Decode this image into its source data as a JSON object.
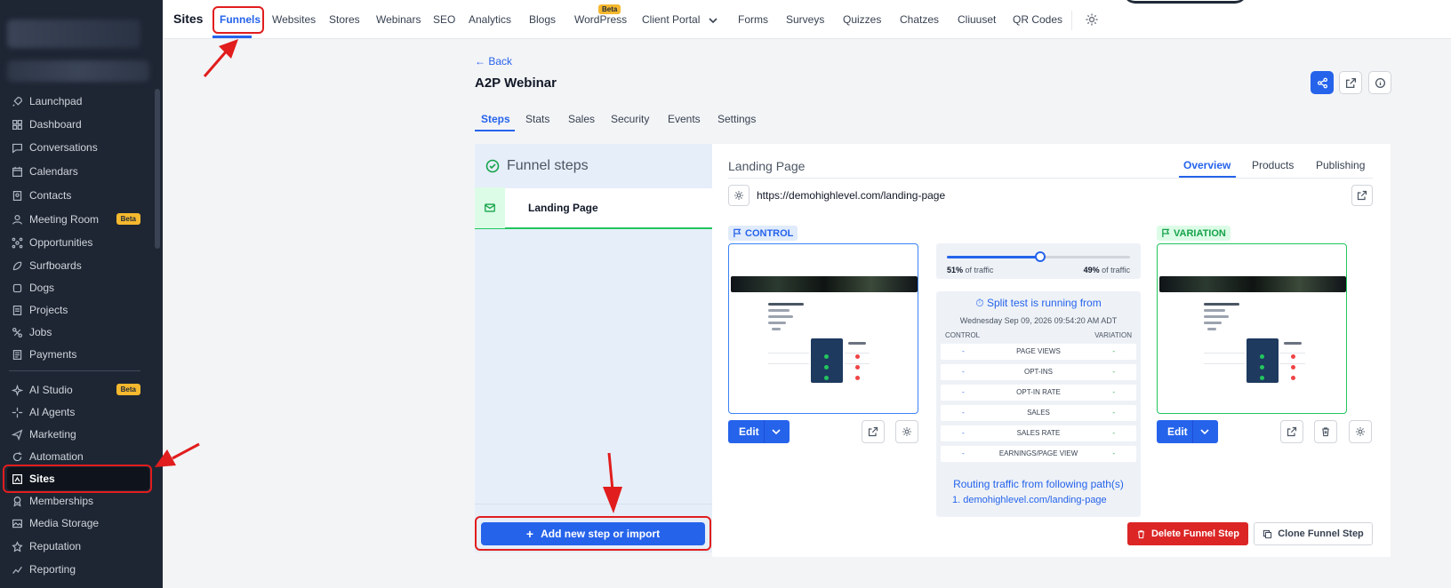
{
  "sidebar": {
    "items": [
      {
        "label": "Launchpad",
        "icon": "rocket-icon"
      },
      {
        "label": "Dashboard",
        "icon": "grid-icon"
      },
      {
        "label": "Conversations",
        "icon": "chat-icon"
      },
      {
        "label": "Calendars",
        "icon": "calendar-icon"
      },
      {
        "label": "Contacts",
        "icon": "contacts-icon"
      },
      {
        "label": "Meeting Room",
        "icon": "meeting-icon",
        "badge": "Beta"
      },
      {
        "label": "Opportunities",
        "icon": "opportunities-icon"
      },
      {
        "label": "Surfboards",
        "icon": "surfboard-icon"
      },
      {
        "label": "Dogs",
        "icon": "dog-icon"
      },
      {
        "label": "Projects",
        "icon": "projects-icon"
      },
      {
        "label": "Jobs",
        "icon": "jobs-icon"
      },
      {
        "label": "Payments",
        "icon": "payments-icon"
      },
      {
        "label": "AI Studio",
        "icon": "ai-studio-icon",
        "badge": "Beta"
      },
      {
        "label": "AI Agents",
        "icon": "ai-agents-icon"
      },
      {
        "label": "Marketing",
        "icon": "send-icon"
      },
      {
        "label": "Automation",
        "icon": "automation-icon"
      },
      {
        "label": "Sites",
        "icon": "sites-icon"
      },
      {
        "label": "Memberships",
        "icon": "memberships-icon"
      },
      {
        "label": "Media Storage",
        "icon": "media-icon"
      },
      {
        "label": "Reputation",
        "icon": "star-icon"
      },
      {
        "label": "Reporting",
        "icon": "chart-icon"
      }
    ]
  },
  "topnav": {
    "title": "Sites",
    "items": [
      "Funnels",
      "Websites",
      "Stores",
      "Webinars",
      "SEO",
      "Analytics",
      "Blogs",
      "WordPress",
      "Client Portal",
      "Forms",
      "Surveys",
      "Quizzes",
      "Chatzes",
      "Cliuuset",
      "QR Codes"
    ],
    "seo_badge": "Beta"
  },
  "page": {
    "back": "← Back",
    "title": "A2P Webinar",
    "tabs": [
      "Steps",
      "Stats",
      "Sales",
      "Security",
      "Events",
      "Settings"
    ]
  },
  "steps": {
    "heading": "Funnel steps",
    "items": [
      "Landing Page"
    ],
    "add_button": "Add new step or import"
  },
  "detail": {
    "title": "Landing Page",
    "tabs": [
      "Overview",
      "Products",
      "Publishing"
    ],
    "url": "https://demohighlevel.com/landing-page",
    "control_tag": "CONTROL",
    "variation_tag": "VARIATION",
    "edit_label": "Edit",
    "traffic": {
      "control_pct": 51,
      "variation_pct": 49,
      "control_label": "51%",
      "variation_label": "49%",
      "suffix": "of traffic"
    },
    "split": {
      "title": "Split test is running from",
      "date": "Wednesday Sep 09, 2026 09:54:20 AM ADT",
      "control_header": "CONTROL",
      "variation_header": "VARIATION",
      "metrics": [
        {
          "name": "PAGE VIEWS",
          "control": "-",
          "variation": "-"
        },
        {
          "name": "OPT-INS",
          "control": "-",
          "variation": "-"
        },
        {
          "name": "OPT-IN RATE",
          "control": "-",
          "variation": "-"
        },
        {
          "name": "SALES",
          "control": "-",
          "variation": "-"
        },
        {
          "name": "SALES RATE",
          "control": "-",
          "variation": "-"
        },
        {
          "name": "EARNINGS/PAGE VIEW",
          "control": "-",
          "variation": "-"
        }
      ],
      "routing_title": "Routing traffic from following path(s)",
      "routing_path": "1.  demohighlevel.com/landing-page"
    },
    "delete_button": "Delete Funnel Step",
    "clone_button": "Clone Funnel Step"
  },
  "colors": {
    "primary": "#2563eb",
    "success": "#16a34a",
    "danger": "#dc2626",
    "annotation": "#e11d1d",
    "sidebar": "#1e2634"
  }
}
